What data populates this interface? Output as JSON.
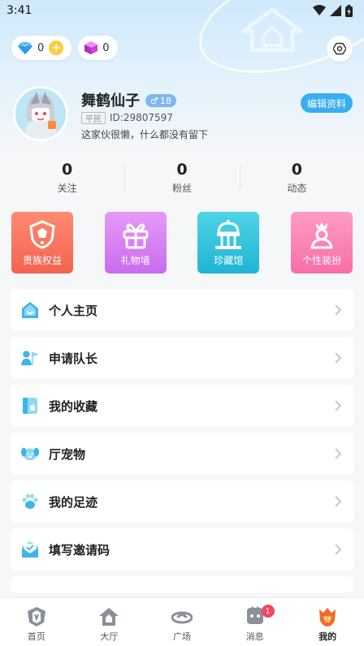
{
  "status_bar": {
    "time": "3:41"
  },
  "currency": {
    "diamonds": "0",
    "gems": "0"
  },
  "profile": {
    "name": "舞鹤仙子",
    "gender_symbol": "♂",
    "age": "18",
    "rank": "平民",
    "user_id": "ID:29807597",
    "bio": "这家伙很懒，什么都没有留下",
    "edit_label": "编辑资料"
  },
  "stats": [
    {
      "value": "0",
      "label": "关注"
    },
    {
      "value": "0",
      "label": "粉丝"
    },
    {
      "value": "0",
      "label": "动态"
    }
  ],
  "features": [
    {
      "label": "贵族权益",
      "icon": "noble-crest-icon"
    },
    {
      "label": "礼物墙",
      "icon": "gift-box-icon"
    },
    {
      "label": "珍藏馆",
      "icon": "museum-icon"
    },
    {
      "label": "个性装扮",
      "icon": "dress-up-icon"
    }
  ],
  "menu": [
    {
      "label": "个人主页",
      "icon": "home-icon"
    },
    {
      "label": "申请队长",
      "icon": "captain-flag-icon"
    },
    {
      "label": "我的收藏",
      "icon": "collection-icon"
    },
    {
      "label": "厅宠物",
      "icon": "pet-icon"
    },
    {
      "label": "我的足迹",
      "icon": "paw-print-icon"
    },
    {
      "label": "填写邀请码",
      "icon": "invite-envelope-icon"
    }
  ],
  "tabs": [
    {
      "label": "首页",
      "icon": "home-shield-icon"
    },
    {
      "label": "大厅",
      "icon": "hall-icon"
    },
    {
      "label": "广场",
      "icon": "plaza-icon"
    },
    {
      "label": "消息",
      "icon": "message-icon",
      "badge": "1"
    },
    {
      "label": "我的",
      "icon": "profile-icon",
      "active": true
    }
  ],
  "colors": {
    "accent": "#38aef0",
    "badge_red": "#f4465e",
    "active_tab": "#f26a2c"
  }
}
